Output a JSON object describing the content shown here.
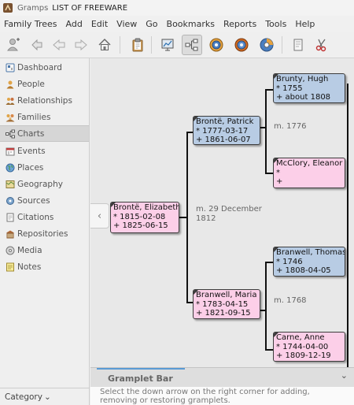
{
  "window": {
    "app_name": "Gramps",
    "title": "LIST OF FREEWARE"
  },
  "menubar": [
    "Family Trees",
    "Add",
    "Edit",
    "View",
    "Go",
    "Bookmarks",
    "Reports",
    "Tools",
    "Help"
  ],
  "toolbar": {
    "icons": [
      "person-add-icon",
      "person-back-icon",
      "back-arrow-icon",
      "forward-arrow-icon",
      "home-icon",
      "clipboard-icon",
      "pedigree-view-icon",
      "fan-chart-icon",
      "fan-descendant-icon",
      "fan-twoway-icon",
      "report-icon",
      "tools-icon"
    ]
  },
  "sidebar": {
    "items": [
      {
        "label": "Dashboard",
        "icon": "dashboard-icon"
      },
      {
        "label": "People",
        "icon": "people-icon"
      },
      {
        "label": "Relationships",
        "icon": "relationships-icon"
      },
      {
        "label": "Families",
        "icon": "families-icon"
      },
      {
        "label": "Charts",
        "icon": "charts-icon",
        "active": true
      },
      {
        "label": "Events",
        "icon": "events-icon"
      },
      {
        "label": "Places",
        "icon": "places-icon"
      },
      {
        "label": "Geography",
        "icon": "geography-icon"
      },
      {
        "label": "Sources",
        "icon": "sources-icon"
      },
      {
        "label": "Citations",
        "icon": "citations-icon"
      },
      {
        "label": "Repositories",
        "icon": "repositories-icon"
      },
      {
        "label": "Media",
        "icon": "media-icon"
      },
      {
        "label": "Notes",
        "icon": "notes-icon"
      }
    ],
    "category_label": "Category",
    "category_chevron": "⌄"
  },
  "pedigree": {
    "people": {
      "root": {
        "name": "Brontë, Elizabeth",
        "birth": "* 1815-02-08",
        "death": "+ 1825-06-15",
        "sex": "female"
      },
      "father": {
        "name": "Brontë, Patrick",
        "birth": "* 1777-03-17",
        "death": "+ 1861-06-07",
        "sex": "male"
      },
      "mother": {
        "name": "Branwell, Maria",
        "birth": "* 1783-04-15",
        "death": "+ 1821-09-15",
        "sex": "female"
      },
      "pat_grandfather": {
        "name": "Brunty, Hugh",
        "birth": "* 1755",
        "death": "+ about 1808",
        "sex": "male"
      },
      "pat_grandmother": {
        "name": "McClory, Eleanor",
        "birth": "*",
        "death": "+",
        "sex": "female"
      },
      "mat_grandfather": {
        "name": "Branwell, Thomas",
        "birth": "* 1746",
        "death": "+ 1808-04-05",
        "sex": "male"
      },
      "mat_grandmother": {
        "name": "Carne, Anne",
        "birth": "* 1744-04-00",
        "death": "+ 1809-12-19",
        "sex": "female"
      }
    },
    "marriages": {
      "parents_line1": "m. 29 December",
      "parents_line2": "1812",
      "paternal": "m. 1776",
      "maternal": "m. 1768"
    },
    "nav_left_arrow": "‹"
  },
  "gramplet": {
    "tab_label": "Gramplet Bar",
    "dropdown": "⌄",
    "message": "Select the down arrow on the right corner for adding, removing or restoring gramplets."
  },
  "colors": {
    "male_box": "#b8cce4",
    "female_box": "#fccfe8",
    "tab_accent": "#5a9bd5"
  }
}
